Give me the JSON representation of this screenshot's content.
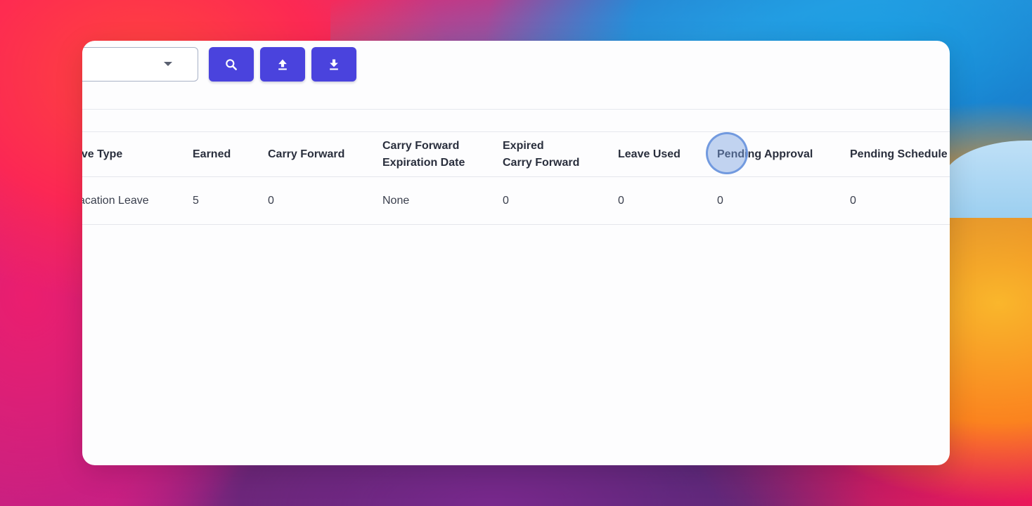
{
  "toolbar": {
    "select_value": "",
    "buttons": [
      {
        "icon": "search-icon",
        "color": "#4a43dd"
      },
      {
        "icon": "upload-icon",
        "color": "#4a43dd"
      },
      {
        "icon": "download-icon",
        "color": "#4a43dd"
      }
    ]
  },
  "table": {
    "headers": {
      "leave_type": "ave Type",
      "earned": "Earned",
      "carry_forward": "Carry Forward",
      "cf_expiration_line1": "Carry Forward",
      "cf_expiration_line2": "Expiration Date",
      "expired_cf_line1": "Expired",
      "expired_cf_line2": "Carry Forward",
      "leave_used": "Leave Used",
      "pending_approval": "Pending Approval",
      "pending_schedule": "Pending Schedule"
    },
    "rows": [
      {
        "leave_type": "acation Leave",
        "earned": "5",
        "carry_forward": "0",
        "cf_expiration": "None",
        "expired_cf": "0",
        "leave_used": "0",
        "pending_approval": "0",
        "pending_schedule": "0"
      }
    ]
  },
  "colors": {
    "accent": "#4a43dd",
    "header_text": "#2a2f3d",
    "cell_text": "#3a3f4d"
  }
}
